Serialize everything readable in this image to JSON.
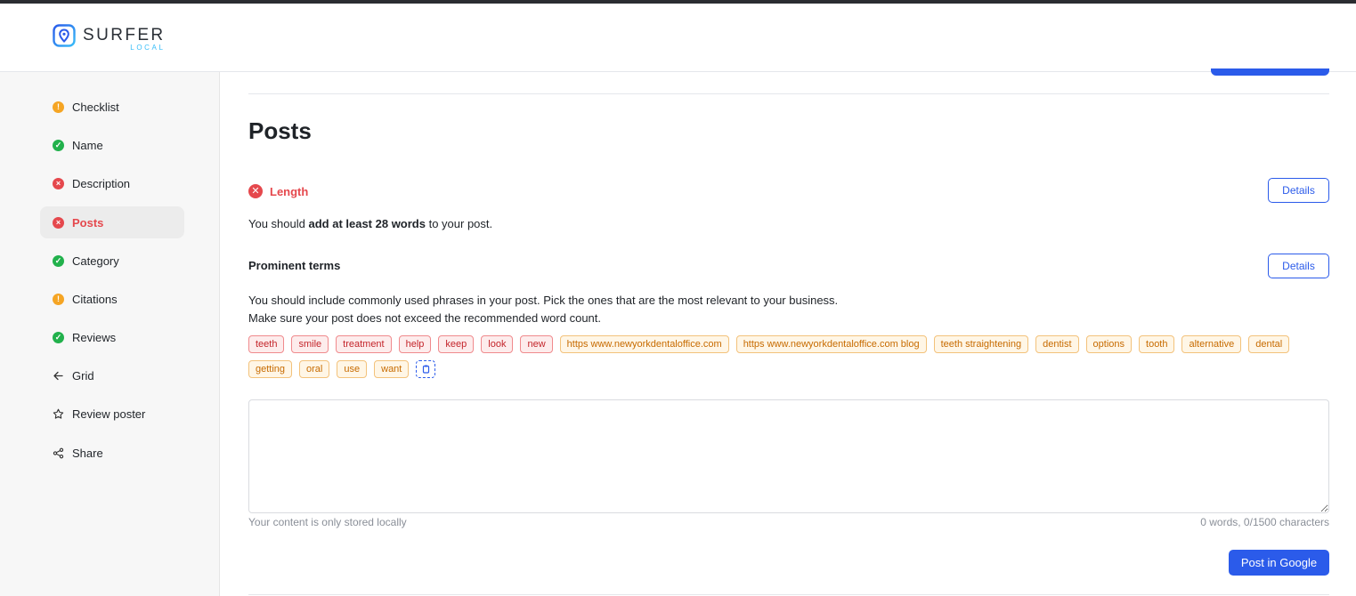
{
  "app": {
    "logo_main": "SURFER",
    "logo_sub": "LOCAL",
    "brand_color": "#2b5bea"
  },
  "sidebar": {
    "items": [
      {
        "label": "Checklist",
        "status": "warning",
        "icon": "warning-dot-icon"
      },
      {
        "label": "Name",
        "status": "ok",
        "icon": "check-dot-icon"
      },
      {
        "label": "Description",
        "status": "error",
        "icon": "error-dot-icon"
      },
      {
        "label": "Posts",
        "status": "error",
        "icon": "error-dot-icon",
        "active": true
      },
      {
        "label": "Category",
        "status": "ok",
        "icon": "check-dot-icon"
      },
      {
        "label": "Citations",
        "status": "warning",
        "icon": "warning-dot-icon"
      },
      {
        "label": "Reviews",
        "status": "ok",
        "icon": "check-dot-icon"
      },
      {
        "label": "Grid",
        "icon": "arrow-left-icon"
      },
      {
        "label": "Review poster",
        "icon": "star-icon"
      },
      {
        "label": "Share",
        "icon": "share-icon"
      }
    ]
  },
  "main": {
    "title": "Posts",
    "length": {
      "title": "Length",
      "details_label": "Details",
      "text_before": "You should ",
      "text_bold": "add at least 28 words",
      "text_after": " to your post."
    },
    "prominent": {
      "title": "Prominent terms",
      "details_label": "Details",
      "desc_line1": "You should include commonly used phrases in your post. Pick the ones that are the most relevant to your business.",
      "desc_line2": "Make sure your post does not exceed the recommended word count."
    },
    "tags": [
      {
        "text": "teeth",
        "color": "red"
      },
      {
        "text": "smile",
        "color": "red"
      },
      {
        "text": "treatment",
        "color": "red"
      },
      {
        "text": "help",
        "color": "red"
      },
      {
        "text": "keep",
        "color": "red"
      },
      {
        "text": "look",
        "color": "red"
      },
      {
        "text": "new",
        "color": "red"
      },
      {
        "text": "https www.newyorkdentaloffice.com",
        "color": "orange"
      },
      {
        "text": "https www.newyorkdentaloffice.com blog",
        "color": "orange"
      },
      {
        "text": "teeth straightening",
        "color": "orange"
      },
      {
        "text": "dentist",
        "color": "orange"
      },
      {
        "text": "options",
        "color": "orange"
      },
      {
        "text": "tooth",
        "color": "orange"
      },
      {
        "text": "alternative",
        "color": "orange"
      },
      {
        "text": "dental",
        "color": "orange"
      },
      {
        "text": "getting",
        "color": "orange"
      },
      {
        "text": "oral",
        "color": "orange"
      },
      {
        "text": "use",
        "color": "orange"
      },
      {
        "text": "want",
        "color": "orange"
      }
    ],
    "editor": {
      "value": "",
      "storage_note": "Your content is only stored locally",
      "counter": "0 words, 0/1500 characters"
    },
    "post_button": "Post in Google"
  },
  "colors": {
    "error": "#e5484d",
    "ok": "#22b14c",
    "warning": "#f5a524",
    "accent": "#2b5bea"
  }
}
